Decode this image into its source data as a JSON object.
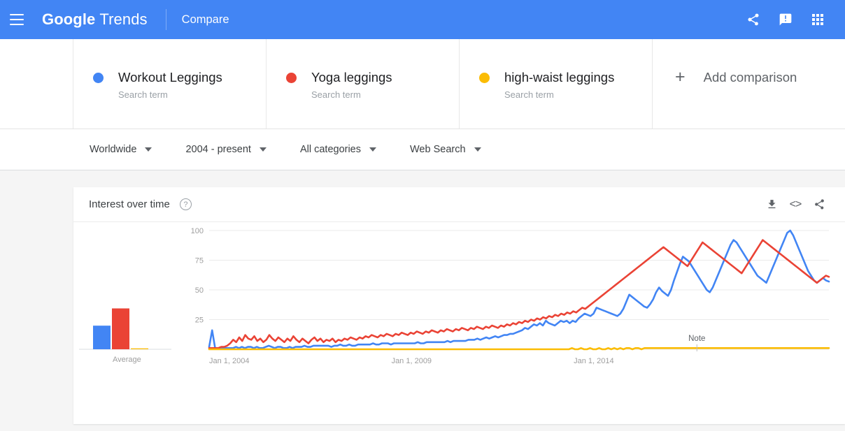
{
  "header": {
    "menu_icon": "hamburger-icon",
    "brand_google": "Google",
    "brand_trends": "Trends",
    "nav_compare": "Compare",
    "share_icon": "share-icon",
    "feedback_icon": "feedback-icon",
    "apps_icon": "apps-grid-icon",
    "background_color": "#4285f4"
  },
  "comparison": {
    "terms": [
      {
        "name": "Workout Leggings",
        "type": "Search term",
        "color": "#4285f4"
      },
      {
        "name": "Yoga leggings",
        "type": "Search term",
        "color": "#ea4335"
      },
      {
        "name": "high-waist leggings",
        "type": "Search term",
        "color": "#fbbc04"
      }
    ],
    "add_label": "Add comparison",
    "add_icon": "plus-icon"
  },
  "filters": [
    {
      "label": "Worldwide",
      "name": "location"
    },
    {
      "label": "2004 - present",
      "name": "time-range"
    },
    {
      "label": "All categories",
      "name": "category"
    },
    {
      "label": "Web Search",
      "name": "search-type"
    }
  ],
  "interest_card": {
    "title": "Interest over time",
    "help_icon": "help-circle-icon",
    "download_icon": "download-icon",
    "embed_icon": "embed-code-icon",
    "embed_glyph": "<>",
    "share_icon": "share-icon"
  },
  "chart_data": {
    "type": "line",
    "title": "Interest over time",
    "xlabel": "",
    "ylabel": "",
    "ylim": [
      0,
      100
    ],
    "grid": true,
    "y_ticks": [
      100,
      75,
      50,
      25
    ],
    "x_tick_labels": [
      "Jan 1, 2004",
      "Jan 1, 2009",
      "Jan 1, 2014"
    ],
    "x_tick_positions": [
      0,
      0.2941,
      0.5882
    ],
    "annotations": [
      {
        "label": "Note",
        "x_frac": 0.787
      }
    ],
    "average_panel": {
      "label": "Average",
      "values": [
        26,
        45,
        1
      ]
    },
    "series": [
      {
        "name": "Workout Leggings",
        "color": "#4285f4",
        "values": [
          2,
          16,
          1,
          1,
          1,
          1,
          1,
          1,
          1,
          2,
          1,
          2,
          1,
          2,
          2,
          1,
          2,
          1,
          1,
          2,
          3,
          2,
          1,
          2,
          2,
          1,
          1,
          2,
          1,
          2,
          2,
          2,
          3,
          2,
          2,
          3,
          3,
          3,
          3,
          3,
          3,
          2,
          3,
          3,
          4,
          3,
          3,
          4,
          3,
          3,
          4,
          4,
          4,
          4,
          4,
          5,
          4,
          4,
          5,
          5,
          5,
          4,
          5,
          5,
          5,
          5,
          5,
          5,
          5,
          5,
          6,
          5,
          5,
          6,
          6,
          6,
          6,
          6,
          6,
          6,
          7,
          6,
          7,
          7,
          7,
          7,
          7,
          8,
          8,
          8,
          9,
          8,
          9,
          10,
          9,
          10,
          11,
          10,
          11,
          12,
          12,
          13,
          13,
          14,
          15,
          16,
          18,
          17,
          19,
          21,
          20,
          22,
          20,
          24,
          22,
          21,
          20,
          22,
          24,
          23,
          24,
          22,
          24,
          23,
          26,
          28,
          30,
          29,
          28,
          30,
          35,
          34,
          33,
          32,
          31,
          30,
          29,
          28,
          30,
          34,
          40,
          46,
          44,
          42,
          40,
          38,
          36,
          35,
          38,
          42,
          48,
          52,
          49,
          47,
          45,
          50,
          58,
          65,
          72,
          78,
          76,
          74,
          70,
          66,
          62,
          58,
          54,
          50,
          48,
          52,
          58,
          64,
          70,
          76,
          82,
          88,
          92,
          90,
          86,
          82,
          78,
          74,
          70,
          66,
          62,
          60,
          58,
          56,
          62,
          68,
          74,
          80,
          86,
          92,
          98,
          100,
          96,
          90,
          84,
          78,
          72,
          66,
          62,
          58,
          56,
          58,
          60,
          58,
          57
        ]
      },
      {
        "name": "Yoga leggings",
        "color": "#ea4335",
        "values": [
          1,
          1,
          1,
          1,
          2,
          2,
          3,
          5,
          8,
          6,
          10,
          7,
          12,
          9,
          8,
          11,
          7,
          9,
          6,
          8,
          12,
          9,
          7,
          10,
          8,
          6,
          9,
          7,
          11,
          8,
          6,
          9,
          7,
          5,
          8,
          10,
          7,
          9,
          6,
          8,
          7,
          9,
          6,
          8,
          7,
          9,
          8,
          10,
          9,
          8,
          10,
          9,
          11,
          10,
          12,
          11,
          10,
          12,
          11,
          13,
          12,
          11,
          13,
          12,
          14,
          13,
          12,
          14,
          13,
          15,
          14,
          13,
          15,
          14,
          16,
          15,
          14,
          16,
          15,
          17,
          16,
          15,
          17,
          16,
          18,
          17,
          16,
          18,
          17,
          19,
          18,
          17,
          19,
          18,
          20,
          19,
          18,
          20,
          19,
          21,
          20,
          22,
          21,
          23,
          22,
          24,
          23,
          25,
          24,
          26,
          25,
          27,
          26,
          28,
          27,
          29,
          28,
          30,
          29,
          31,
          30,
          32,
          31,
          33,
          35,
          34,
          36,
          38,
          40,
          42,
          44,
          46,
          48,
          50,
          52,
          54,
          56,
          58,
          60,
          62,
          64,
          66,
          68,
          70,
          72,
          74,
          76,
          78,
          80,
          82,
          84,
          86,
          84,
          82,
          80,
          78,
          76,
          74,
          72,
          70,
          74,
          78,
          82,
          86,
          90,
          88,
          86,
          84,
          82,
          80,
          78,
          76,
          74,
          72,
          70,
          68,
          66,
          64,
          68,
          72,
          76,
          80,
          84,
          88,
          92,
          90,
          88,
          86,
          84,
          82,
          80,
          78,
          76,
          74,
          72,
          70,
          68,
          66,
          64,
          62,
          60,
          58,
          56,
          58,
          60,
          62,
          61
        ]
      },
      {
        "name": "high-waist leggings",
        "color": "#fbbc04",
        "values": [
          0,
          0,
          0,
          0,
          0,
          0,
          0,
          0,
          0,
          0,
          0,
          0,
          0,
          0,
          0,
          0,
          0,
          0,
          0,
          0,
          0,
          0,
          0,
          0,
          0,
          0,
          0,
          0,
          0,
          0,
          0,
          0,
          0,
          0,
          0,
          0,
          0,
          0,
          0,
          0,
          0,
          0,
          0,
          0,
          0,
          0,
          0,
          0,
          0,
          0,
          0,
          0,
          0,
          0,
          0,
          0,
          0,
          0,
          0,
          0,
          0,
          0,
          0,
          0,
          0,
          0,
          0,
          0,
          0,
          0,
          0,
          0,
          0,
          0,
          0,
          0,
          0,
          0,
          0,
          0,
          0,
          0,
          0,
          0,
          0,
          0,
          0,
          0,
          0,
          0,
          0,
          0,
          0,
          0,
          0,
          0,
          0,
          0,
          0,
          0,
          0,
          0,
          0,
          0,
          0,
          0,
          0,
          0,
          0,
          0,
          0,
          0,
          0,
          0,
          0,
          0,
          0,
          0,
          0,
          0,
          1,
          0,
          0,
          1,
          0,
          0,
          1,
          0,
          0,
          1,
          0,
          0,
          1,
          0,
          1,
          0,
          1,
          0,
          1,
          1,
          0,
          1,
          1,
          0,
          1,
          1,
          1,
          1,
          1,
          1,
          1,
          1,
          1,
          1,
          1,
          1,
          1,
          1,
          1,
          1,
          1,
          1,
          1,
          1,
          1,
          1,
          1,
          1,
          1,
          1,
          1,
          1,
          1,
          1,
          1,
          1,
          1,
          1,
          1,
          1,
          1,
          1,
          1,
          1,
          1,
          1,
          1,
          1,
          1,
          1,
          1,
          1,
          1,
          1,
          1,
          1,
          1,
          1,
          1,
          1,
          1,
          1,
          1,
          1,
          1,
          1
        ]
      }
    ]
  }
}
